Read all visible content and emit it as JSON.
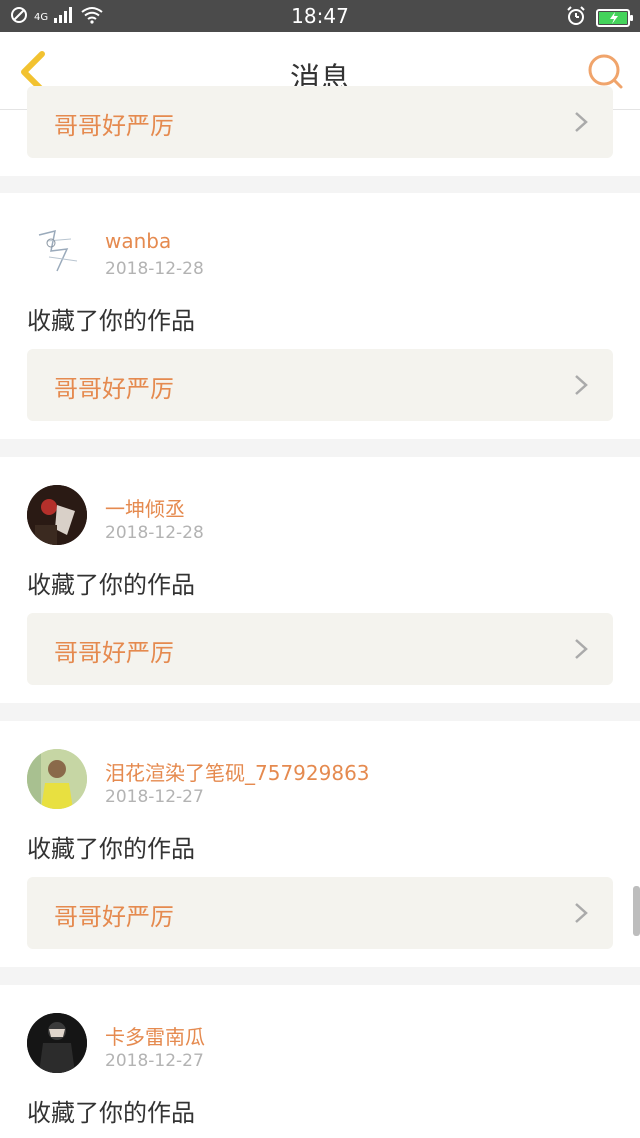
{
  "status_bar": {
    "time": "18:47",
    "network": "4G"
  },
  "header": {
    "title": "消息"
  },
  "top_partial_card": {
    "work_title": "哥哥好严厉"
  },
  "messages": [
    {
      "username": "wanba",
      "date": "2018-12-28",
      "action": "收藏了你的作品",
      "work_title": "哥哥好严厉"
    },
    {
      "username": "一坤倾丞",
      "date": "2018-12-28",
      "action": "收藏了你的作品",
      "work_title": "哥哥好严厉"
    },
    {
      "username": "泪花渲染了笔砚_757929863",
      "date": "2018-12-27",
      "action": "收藏了你的作品",
      "work_title": "哥哥好严厉"
    },
    {
      "username": "卡多雷南瓜",
      "date": "2018-12-27",
      "action": "收藏了你的作品"
    }
  ],
  "colors": {
    "accent": "#e58a4f",
    "back_arrow": "#f2c230",
    "card_bg": "#f4f3ee",
    "page_bg": "#f4f4f4"
  }
}
